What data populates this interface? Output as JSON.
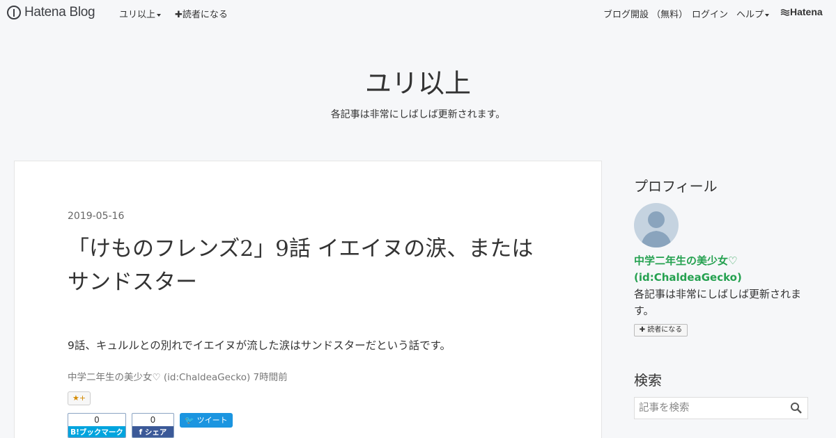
{
  "globalheader": {
    "logo_text": "Hatena Blog",
    "blog_menu": "ユリ以上",
    "subscribe": "読者になる",
    "open_blog": "ブログ開設 （無料）",
    "login": "ログイン",
    "help": "ヘルプ",
    "hatena": "Hatena"
  },
  "blog": {
    "title": "ユリ以上",
    "description": "各記事は非常にしばしば更新されます。"
  },
  "entry": {
    "date": "2019-05-16",
    "title": "「けものフレンズ2」9話 イエイヌの涙、またはサンドスター",
    "body": "9話、キュルルとの別れでイエイヌが流した涙はサンドスターだという話です。",
    "author": "中学二年生の美少女♡ (id:ChaldeaGecko)",
    "time": "7時間前",
    "star_button": "+",
    "share": {
      "hatebu_count": "0",
      "hatebu_label": "B!ブックマーク",
      "facebook_count": "0",
      "facebook_label": "シェア",
      "tweet_label": "ツイート"
    }
  },
  "sidebar": {
    "profile_heading": "プロフィール",
    "profile_name": "中学二年生の美少女♡",
    "profile_id": "(id:ChaldeaGecko)",
    "profile_desc": "各記事は非常にしばしば更新されます。",
    "subscribe": "読者になる",
    "search_heading": "検索",
    "search_placeholder": "記事を検索"
  },
  "colors": {
    "profile_link": "#25a150",
    "hatebu": "#00a4de",
    "facebook": "#3b5998",
    "twitter": "#1b95e0"
  }
}
